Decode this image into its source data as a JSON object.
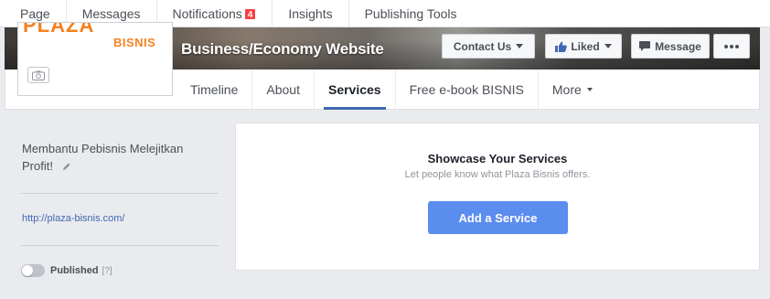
{
  "admin_bar": {
    "tabs": [
      {
        "label": "Page"
      },
      {
        "label": "Messages"
      },
      {
        "label": "Notifications",
        "badge": "4"
      },
      {
        "label": "Insights"
      },
      {
        "label": "Publishing Tools"
      }
    ]
  },
  "page": {
    "name": "Business/Economy Website",
    "logo_text": "PLAZA",
    "logo_subtext": "BISNIS"
  },
  "cover_buttons": {
    "contact_label": "Contact Us",
    "liked_label": "Liked",
    "message_label": "Message"
  },
  "nav": {
    "tabs": [
      {
        "label": "Timeline"
      },
      {
        "label": "About"
      },
      {
        "label": "Services",
        "active": true
      },
      {
        "label": "Free e-book BISNIS"
      },
      {
        "label": "More"
      }
    ]
  },
  "sidebar": {
    "about": "Membantu Pebisnis Melejitkan Profit!",
    "website": "http://plaza-bisnis.com/",
    "published_label": "Published",
    "help_label": "[?]",
    "published_on": false
  },
  "services": {
    "title": "Showcase Your Services",
    "description": "Let people know what Plaza Bisnis offers.",
    "button_label": "Add a Service"
  },
  "colors": {
    "accent": "#4267b2",
    "button_blue": "#5b8def",
    "brand_orange": "#f58220",
    "badge_red": "#fa3e3e"
  }
}
